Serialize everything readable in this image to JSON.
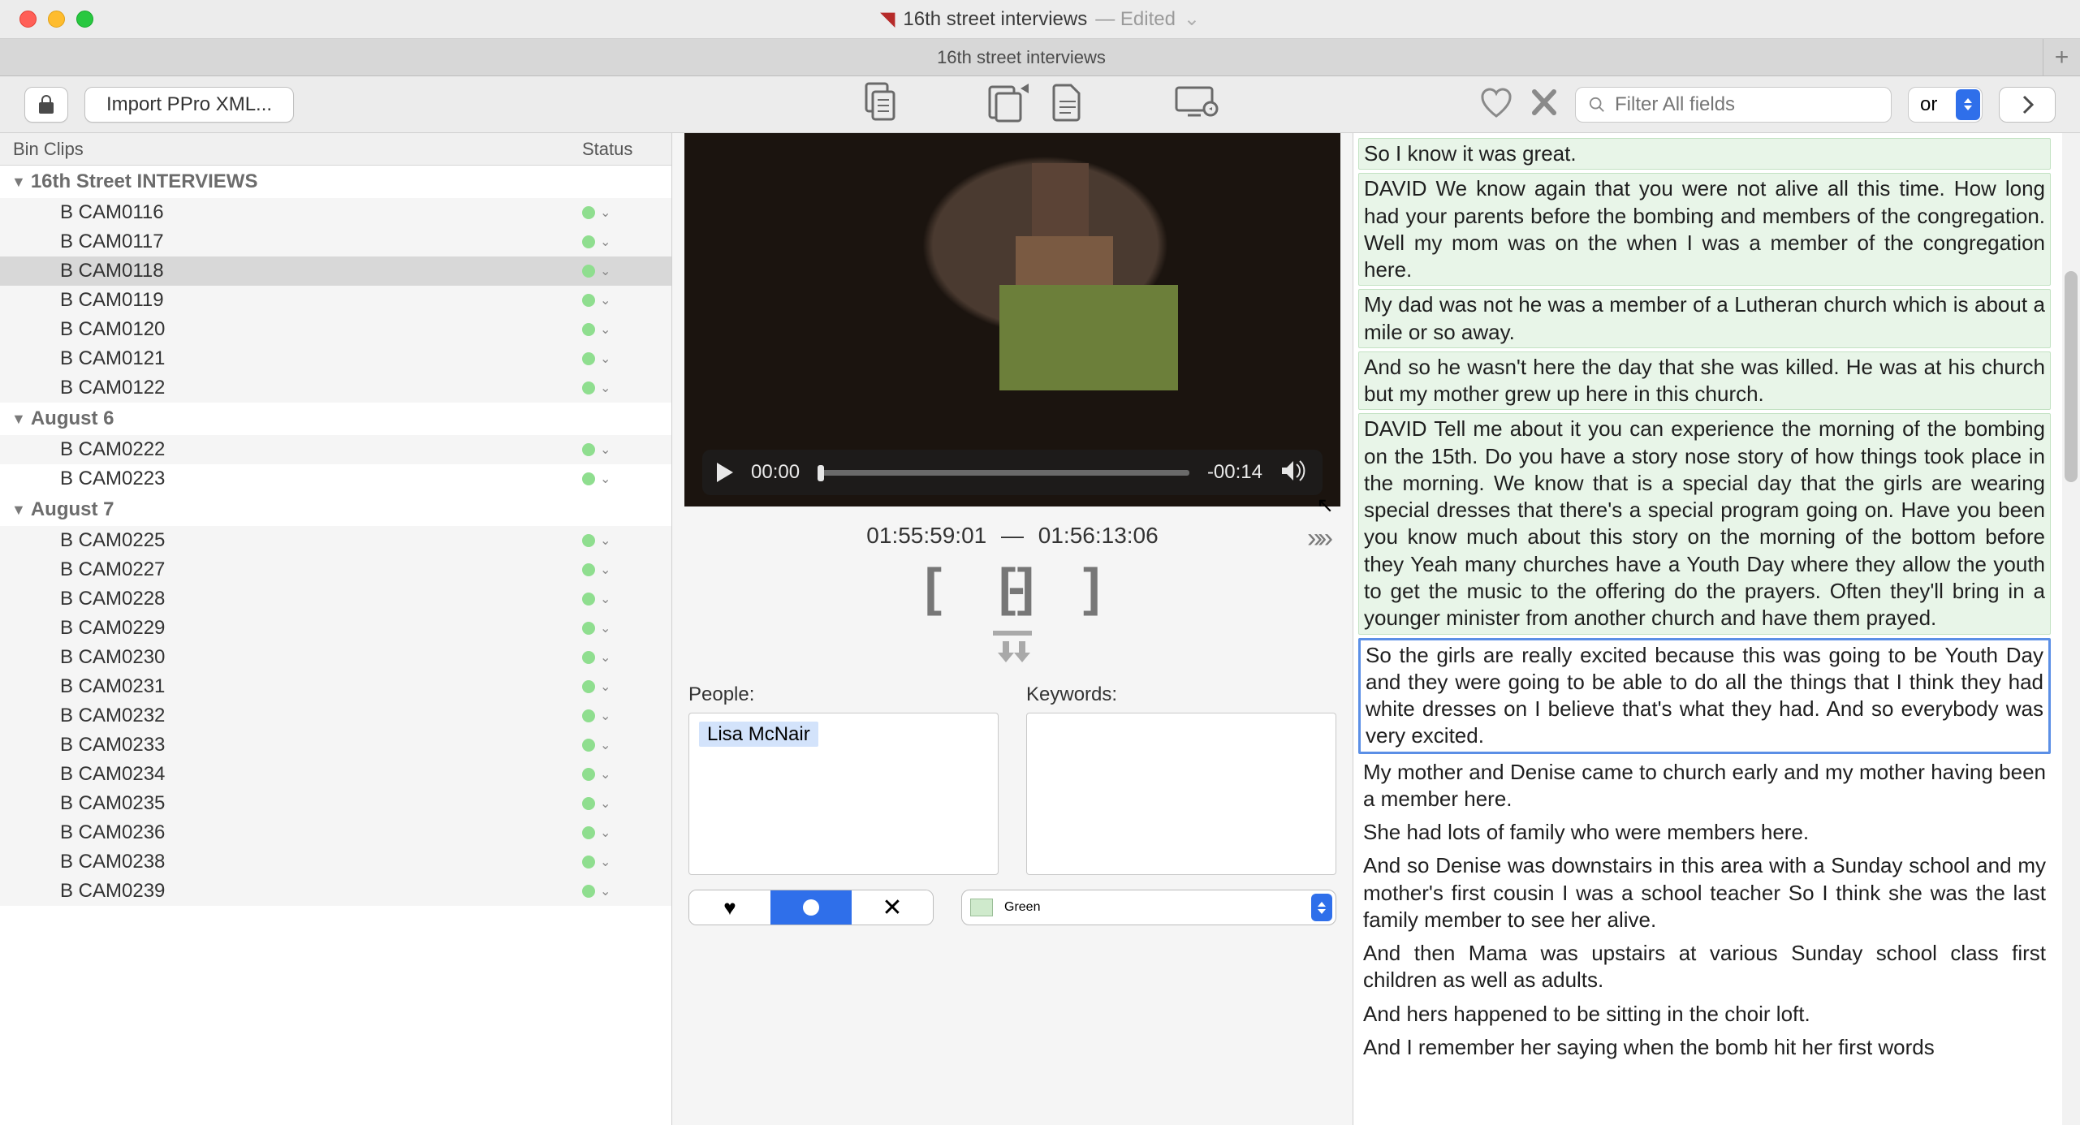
{
  "window": {
    "title": "16th street interviews",
    "edited_label": "— Edited",
    "tab_name": "16th street interviews"
  },
  "toolbar": {
    "import_label": "Import PPro XML...",
    "search_placeholder": "Filter All fields",
    "logic_label": "or"
  },
  "sidebar": {
    "headers": {
      "bin": "Bin Clips",
      "status": "Status"
    },
    "groups": [
      {
        "title": "16th Street INTERVIEWS",
        "items": [
          "B CAM0116",
          "B CAM0117",
          "B CAM0118",
          "B CAM0119",
          "B CAM0120",
          "B CAM0121",
          "B CAM0122"
        ],
        "selected_index": 2
      },
      {
        "title": "August 6",
        "items": [
          "B CAM0222",
          "B CAM0223"
        ]
      },
      {
        "title": "August 7",
        "items": [
          "B CAM0225",
          "B CAM0227",
          "B CAM0228",
          "B CAM0229",
          "B CAM0230",
          "B CAM0231",
          "B CAM0232",
          "B CAM0233",
          "B CAM0234",
          "B CAM0235",
          "B CAM0236",
          "B CAM0238",
          "B CAM0239"
        ]
      }
    ]
  },
  "player": {
    "current_time": "00:00",
    "remaining": "-00:14",
    "in_tc": "01:55:59:01",
    "out_tc": "01:56:13:06",
    "tc_sep": "—"
  },
  "fields": {
    "people_label": "People:",
    "keywords_label": "Keywords:",
    "people_tags": [
      "Lisa McNair"
    ],
    "color_label": "Green"
  },
  "transcript": [
    {
      "style": "green",
      "text": "So I know it was great."
    },
    {
      "style": "green",
      "text": "DAVID We know again that you were not alive all this time. How long had your parents before the bombing and members of the congregation. Well my mom was on the when I was a member of the congregation here."
    },
    {
      "style": "green",
      "text": "My dad was not he was a member of a Lutheran church which is about a mile or so away."
    },
    {
      "style": "green",
      "text": "And so he wasn't here the day that she was killed. He was at his church but my mother grew up here in this church."
    },
    {
      "style": "green",
      "text": "DAVID Tell me about it you can experience the morning of the bombing on the 15th. Do you have a story nose story of how things took place in the morning. We know that is a special day that the girls are wearing special dresses that there's a special program going on. Have you been you know much about this story on the morning of the bottom before they Yeah many churches have a Youth Day where they allow the youth to get the music to the offering do the prayers. Often they'll bring in a younger minister from another church and have them prayed."
    },
    {
      "style": "blue",
      "text": "So the girls are really excited because this was going to be Youth Day and they were going to be able to do all the things that I think they had white dresses on I believe that's what they had. And so everybody was very excited."
    },
    {
      "style": "plain",
      "text": "My mother and Denise came to church early and my mother having been a member here."
    },
    {
      "style": "plain",
      "text": "She had lots of family who were members here."
    },
    {
      "style": "plain",
      "text": "And so Denise was downstairs in this area with a Sunday school and my mother's first cousin I was a school teacher So I think she was the last family member to see her alive."
    },
    {
      "style": "plain",
      "text": "And then Mama was upstairs at various Sunday school class first children as well as adults."
    },
    {
      "style": "plain",
      "text": "And hers happened to be sitting in the choir loft."
    },
    {
      "style": "plain",
      "text": "And I remember her saying when the bomb hit her first words"
    }
  ]
}
